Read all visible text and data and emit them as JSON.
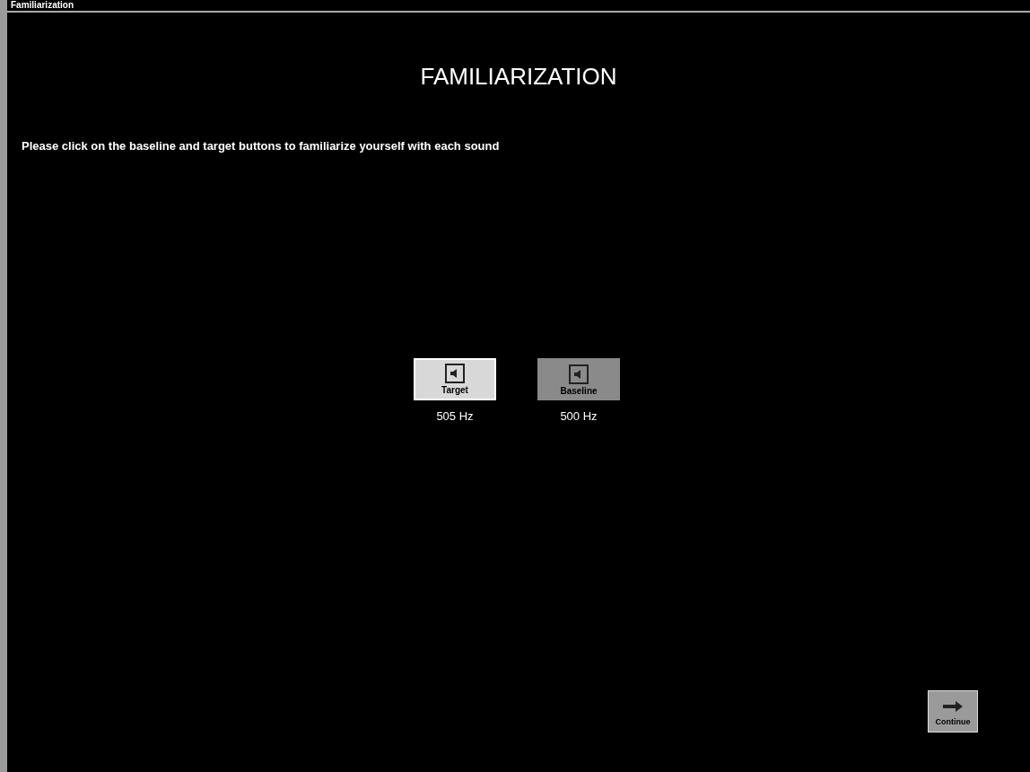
{
  "window": {
    "title": "Familiarization"
  },
  "heading": "FAMILIARIZATION",
  "instruction": "Please click on the baseline and target buttons to familiarize yourself with each sound",
  "sound_buttons": [
    {
      "label": "Target",
      "frequency": "505 Hz",
      "selected": true
    },
    {
      "label": "Baseline",
      "frequency": "500 Hz",
      "selected": false
    }
  ],
  "continue_button": {
    "label": "Continue"
  }
}
